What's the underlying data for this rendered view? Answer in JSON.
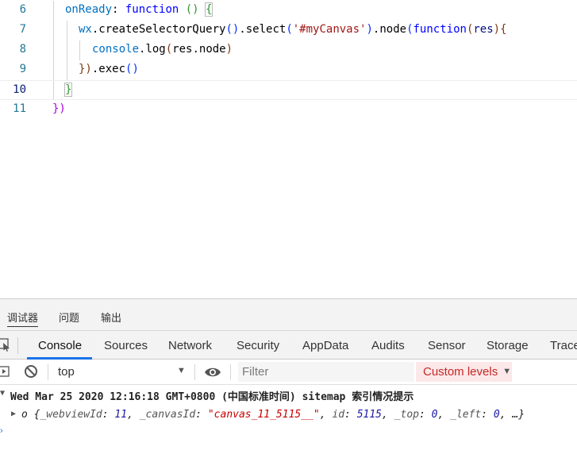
{
  "editor": {
    "lines": [
      {
        "num": "6"
      },
      {
        "num": "7"
      },
      {
        "num": "8"
      },
      {
        "num": "9"
      },
      {
        "num": "10"
      },
      {
        "num": "11"
      }
    ],
    "tokens": {
      "onReady": "onReady",
      "colon": ": ",
      "function_kw": "function",
      "parens": " () ",
      "open_brace": "{",
      "wx": "wx",
      "create": ".createSelectorQuery",
      "call_empty": "()",
      "select": ".select",
      "lp": "(",
      "selector_str": "'#myCanvas'",
      "rp": ")",
      "node": ".node",
      "res": "res",
      "rp_brace": "){",
      "console": "console",
      "log": ".log",
      "res_node": "res.node",
      "close_call": "})",
      "exec": ".exec",
      "close_brace": "}",
      "close_all": "})"
    }
  },
  "devtools": {
    "panel_tabs": [
      "调试器",
      "问题",
      "输出"
    ],
    "tabs": [
      "Console",
      "Sources",
      "Network",
      "Security",
      "AppData",
      "Audits",
      "Sensor",
      "Storage",
      "Trace"
    ],
    "active_tab": "Console",
    "toolbar": {
      "context": "top",
      "filter_placeholder": "Filter",
      "levels": "Custom levels"
    },
    "console": {
      "group_header": "Wed Mar 25 2020 12:16:18 GMT+0800 (中国标准时间) sitemap 索引情况提示",
      "object_prefix": "o",
      "object": {
        "webviewId_key": "_webviewId",
        "webviewId_val": "11",
        "canvasId_key": "_canvasId",
        "canvasId_val": "\"canvas_11_5115__\"",
        "id_key": "id",
        "id_val": "5115",
        "top_key": "_top",
        "top_val": "0",
        "left_key": "_left",
        "left_val": "0",
        "ellipsis": "…"
      }
    }
  },
  "colors": {
    "accent": "#1a73e8",
    "levels_bg": "#fce8e8",
    "levels_text": "#c62828",
    "line_number": "#237893"
  }
}
